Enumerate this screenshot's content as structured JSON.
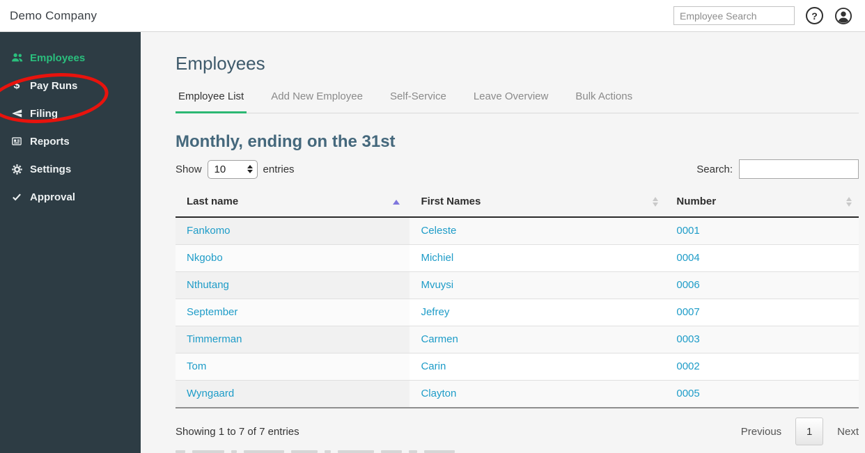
{
  "topbar": {
    "company": "Demo Company",
    "search_placeholder": "Employee Search",
    "help_glyph": "?"
  },
  "sidebar": {
    "items": [
      {
        "label": "Employees",
        "icon": "users-icon",
        "active": true
      },
      {
        "label": "Pay Runs",
        "icon": "dollar-icon",
        "active": false
      },
      {
        "label": "Filing",
        "icon": "paper-plane-icon",
        "active": false
      },
      {
        "label": "Reports",
        "icon": "newspaper-icon",
        "active": false
      },
      {
        "label": "Settings",
        "icon": "gear-icon",
        "active": false
      },
      {
        "label": "Approval",
        "icon": "check-icon",
        "active": false
      }
    ],
    "dollar_glyph": "$"
  },
  "main": {
    "title": "Employees",
    "tabs": [
      {
        "label": "Employee List",
        "active": true
      },
      {
        "label": "Add New Employee",
        "active": false
      },
      {
        "label": "Self-Service",
        "active": false
      },
      {
        "label": "Leave Overview",
        "active": false
      },
      {
        "label": "Bulk Actions",
        "active": false
      }
    ],
    "section_title": "Monthly, ending on the 31st",
    "controls": {
      "show_label": "Show",
      "entries_value": "10",
      "entries_suffix": "entries",
      "search_label": "Search:",
      "search_value": ""
    },
    "table": {
      "columns": [
        {
          "label": "Last name",
          "sort": "asc"
        },
        {
          "label": "First Names",
          "sort": "none"
        },
        {
          "label": "Number",
          "sort": "none"
        }
      ],
      "rows": [
        [
          "Fankomo",
          "Celeste",
          "0001"
        ],
        [
          "Nkgobo",
          "Michiel",
          "0004"
        ],
        [
          "Nthutang",
          "Mvuysi",
          "0006"
        ],
        [
          "September",
          "Jefrey",
          "0007"
        ],
        [
          "Timmerman",
          "Carmen",
          "0003"
        ],
        [
          "Tom",
          "Carin",
          "0002"
        ],
        [
          "Wyngaard",
          "Clayton",
          "0005"
        ]
      ]
    },
    "footer": {
      "summary": "Showing 1 to 7 of 7 entries",
      "previous_label": "Previous",
      "page": "1",
      "next_label": "Next"
    }
  },
  "colors": {
    "sidebar_bg": "#2d3c44",
    "active_item_green": "#2abf7d",
    "tab_underline_green": "#2cb873",
    "link_blue": "#1e9cc8",
    "annotation_red": "#e8130d",
    "sort_active_arrow": "#7f76dd",
    "heading_slate": "#45687c"
  }
}
